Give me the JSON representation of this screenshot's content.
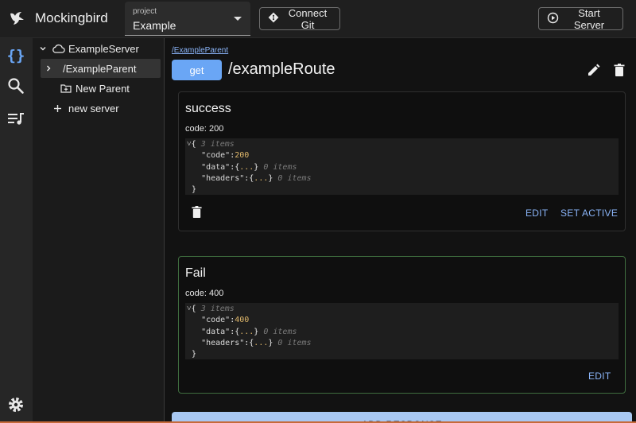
{
  "app": {
    "title": "Mockingbird"
  },
  "project": {
    "label": "project",
    "value": "Example"
  },
  "toolbar": {
    "connect_git": "Connect Git",
    "start_server": "Start Server"
  },
  "rail": {
    "items": [
      "braces-icon",
      "search-icon",
      "playlist-icon",
      "settings-icon"
    ]
  },
  "tree": {
    "server": "ExampleServer",
    "parent": "/ExampleParent",
    "new_parent": "New Parent",
    "new_server": "new server"
  },
  "route": {
    "breadcrumb": "/ExampleParent",
    "method": "get",
    "path": "/exampleRoute"
  },
  "responses": [
    {
      "name": "success",
      "code_label": "code: 200",
      "json": {
        "summary": "3 items",
        "code_key": "\"code\"",
        "code_val": "200",
        "data_key": "\"data\"",
        "data_summary": "0 items",
        "headers_key": "\"headers\"",
        "headers_summary": "0 items",
        "ellipsis": "..."
      },
      "actions": {
        "edit": "EDIT",
        "set_active": "SET ACTIVE"
      }
    },
    {
      "name": "Fail",
      "code_label": "code: 400",
      "json": {
        "summary": "3 items",
        "code_key": "\"code\"",
        "code_val": "400",
        "data_key": "\"data\"",
        "data_summary": "0 items",
        "headers_key": "\"headers\"",
        "headers_summary": "0 items",
        "ellipsis": "..."
      },
      "actions": {
        "edit": "EDIT"
      }
    }
  ],
  "add_response": "ADD RESPONSE",
  "colors": {
    "accent": "#8ab4f8",
    "method_bg": "#6aa6f5",
    "active_border": "#3f6e3f"
  }
}
